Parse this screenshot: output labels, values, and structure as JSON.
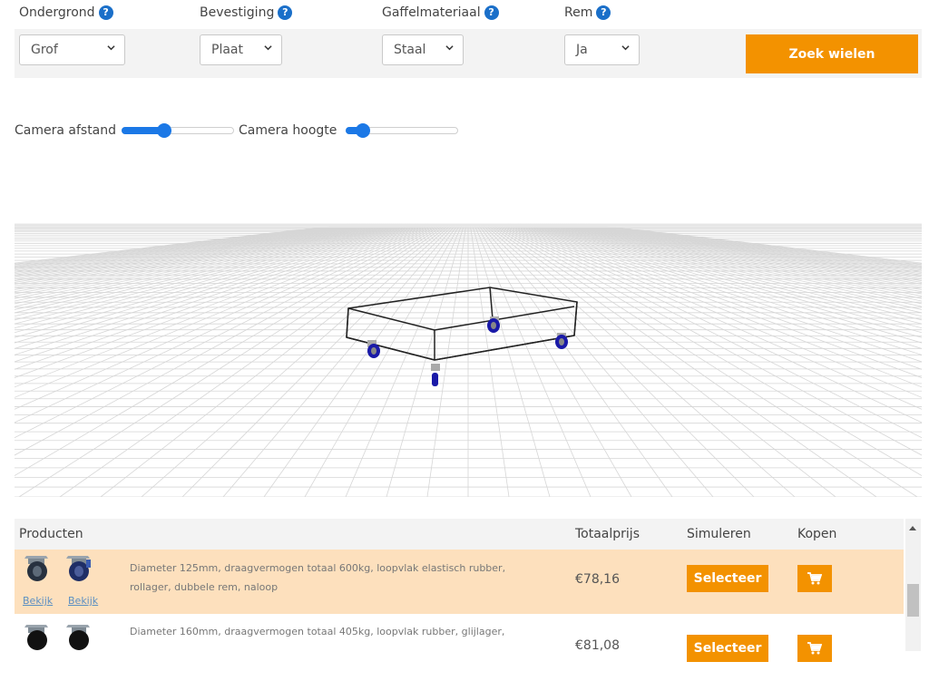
{
  "filters": [
    {
      "label": "Ondergrond",
      "value": "Grof"
    },
    {
      "label": "Bevestiging",
      "value": "Plaat"
    },
    {
      "label": "Gaffelmateriaal",
      "value": "Staal"
    },
    {
      "label": "Rem",
      "value": "Ja"
    }
  ],
  "help_icon_glyph": "?",
  "search_button": "Zoek wielen",
  "camera": {
    "distance_label": "Camera afstand",
    "distance_value_fraction": 0.38,
    "height_label": "Camera hoogte",
    "height_value_fraction": 0.15
  },
  "table": {
    "headers": {
      "products": "Producten",
      "total": "Totaalprijs",
      "simulate": "Simuleren",
      "buy": "Kopen"
    },
    "rows": [
      {
        "bekijk1": "Bekijk",
        "bekijk2": "Bekijk",
        "description": "Diameter 125mm, draagvermogen totaal 600kg, loopvlak elastisch rubber, rollager, dubbele rem, naloop",
        "price": "€78,16",
        "select_label": "Selecteer",
        "highlighted": true
      },
      {
        "description": "Diameter 160mm, draagvermogen totaal 405kg, loopvlak rubber, glijlager,",
        "price": "€81,08",
        "select_label": "Selecteer",
        "highlighted": false
      }
    ]
  },
  "colors": {
    "accent": "#f39200",
    "slider": "#1b78e6",
    "row_highlight": "#fde0bd",
    "help": "#1a6fc9"
  },
  "icons": {
    "help": "question-circle-icon",
    "cart": "shopping-cart-icon",
    "dropdown": "chevron-down-icon"
  }
}
